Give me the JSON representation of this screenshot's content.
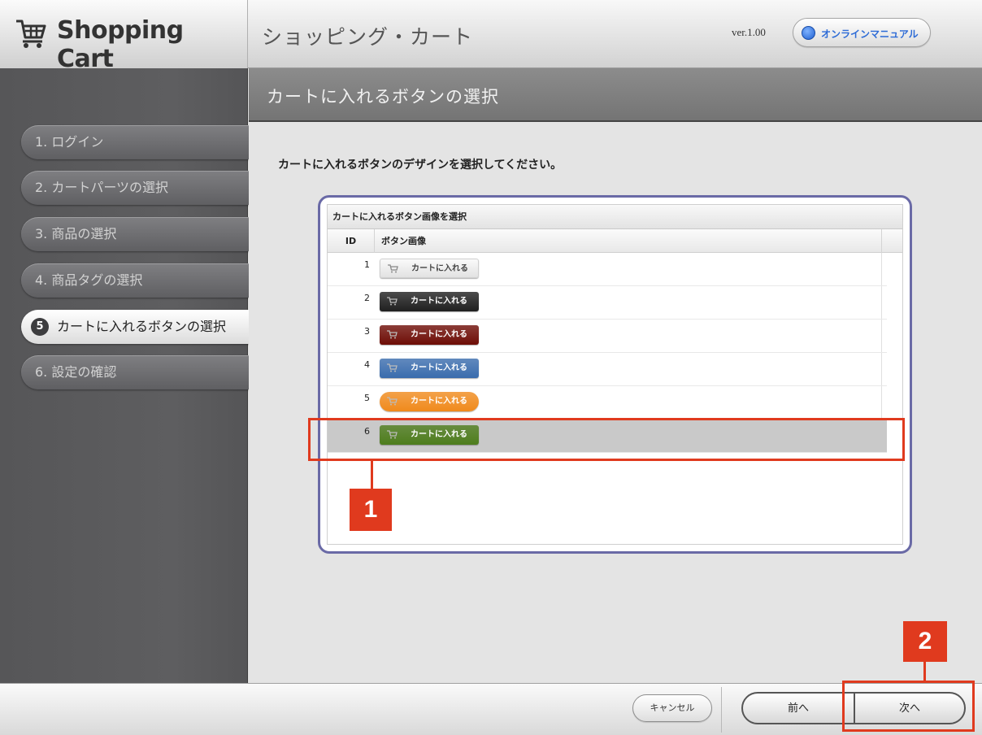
{
  "header": {
    "app_name": "Shopping Cart",
    "page_title": "ショッピング・カート",
    "version": "ver.1.00",
    "manual_button": "オンラインマニュアル"
  },
  "sidebar": {
    "steps": [
      {
        "label": "1.  ログイン",
        "active": false
      },
      {
        "label": "2.  カートパーツの選択",
        "active": false
      },
      {
        "label": "3.  商品の選択",
        "active": false
      },
      {
        "label": "4.  商品タグの選択",
        "active": false
      },
      {
        "number": "5",
        "label": "カートに入れるボタンの選択",
        "active": true
      },
      {
        "label": "6.  設定の確認",
        "active": false
      }
    ]
  },
  "section": {
    "title": "カートに入れるボタンの選択",
    "instruction": "カートに入れるボタンのデザインを選択してください。"
  },
  "table": {
    "caption": "カートに入れるボタン画像を選択",
    "columns": [
      "ID",
      "ボタン画像"
    ],
    "rows": [
      {
        "id": "1",
        "button_label": "カートに入れる",
        "style": "light",
        "bg": "#f1f1f1",
        "fg": "#444444",
        "selected": false
      },
      {
        "id": "2",
        "button_label": "カートに入れる",
        "style": "black",
        "bg": "#1f1f1f",
        "fg": "#ffffff",
        "selected": false
      },
      {
        "id": "3",
        "button_label": "カートに入れる",
        "style": "darkred",
        "bg": "#6e0d06",
        "fg": "#ffffff",
        "selected": false
      },
      {
        "id": "4",
        "button_label": "カートに入れる",
        "style": "blue",
        "bg": "#3a6cad",
        "fg": "#ffffff",
        "selected": false
      },
      {
        "id": "5",
        "button_label": "カートに入れる",
        "style": "orange",
        "bg": "#f08a1c",
        "fg": "#ffffff",
        "selected": false
      },
      {
        "id": "6",
        "button_label": "カートに入れる",
        "style": "green",
        "bg": "#4e7d1d",
        "fg": "#ffffff",
        "selected": true
      }
    ]
  },
  "annotations": {
    "marker_1": "1",
    "marker_2": "2",
    "color": "#e03a1e"
  },
  "footer": {
    "cancel": "キャンセル",
    "prev": "前へ",
    "next": "次へ"
  }
}
